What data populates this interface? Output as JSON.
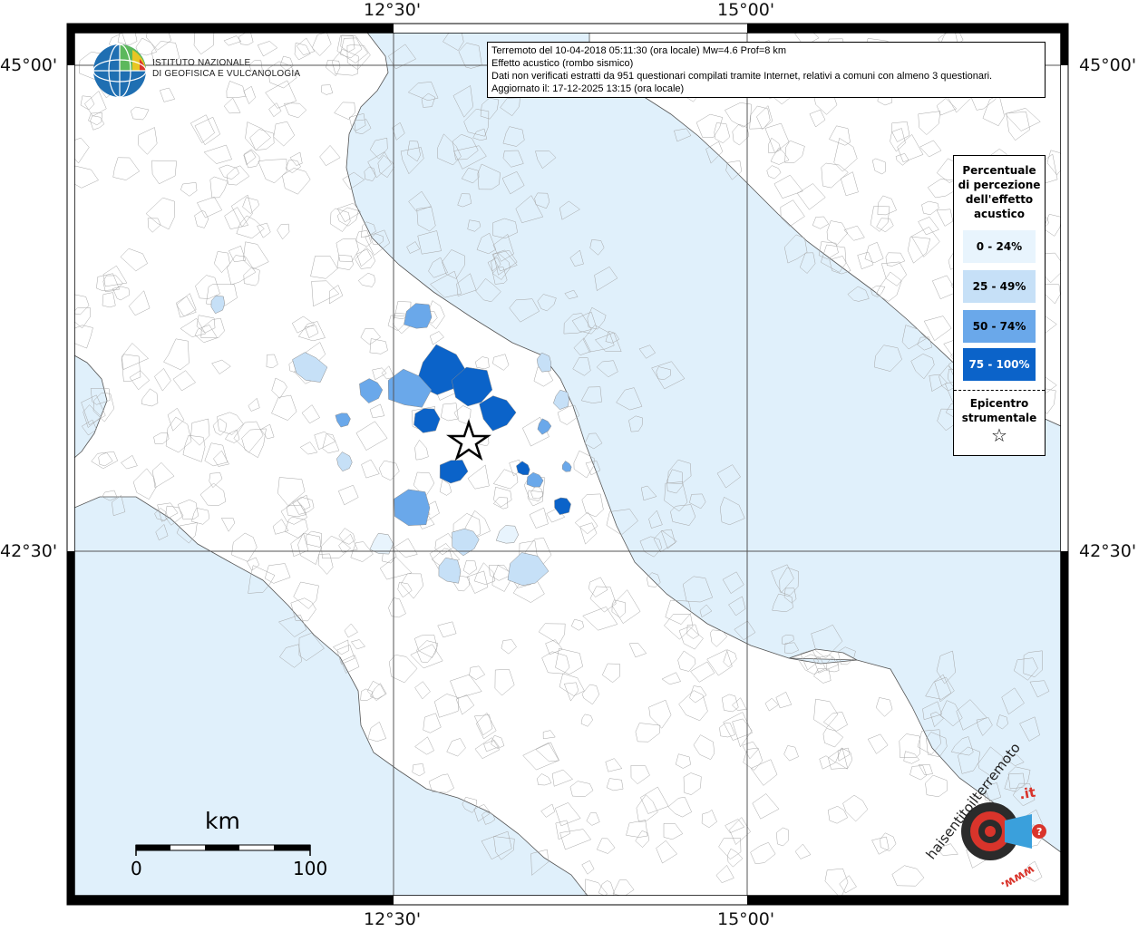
{
  "map": {
    "coord_labels": {
      "top_left_lon": "12°30'",
      "top_right_lon": "15°00'",
      "bottom_left_lon": "12°30'",
      "bottom_right_lon": "15°00'",
      "left_top_lat": "45°00'",
      "left_bottom_lat": "42°30'",
      "right_top_lat": "45°00'",
      "right_bottom_lat": "42°30'"
    },
    "colors": {
      "sea": "#e0f0fb",
      "land": "#ffffff",
      "boundary": "#9a9a9a",
      "frame": "#000000"
    }
  },
  "info": {
    "line1": "Terremoto del 10-04-2018 05:11:30 (ora locale) Mw=4.6 Prof=8 km",
    "line2": "Effetto acustico (rombo sismico)",
    "line3": "Dati non verificati estratti da 951 questionari compilati tramite Internet, relativi a comuni con almeno 3 questionari.",
    "line4": "Aggiornato il: 17-12-2025 13:15 (ora locale)"
  },
  "legend": {
    "title_lines": [
      "Percentuale",
      "di percezione",
      "dell'effetto",
      "acustico"
    ],
    "items": [
      {
        "label": "0 - 24%",
        "color": "#e8f4fd"
      },
      {
        "label": "25 - 49%",
        "color": "#c6e0f7"
      },
      {
        "label": "50 - 74%",
        "color": "#6aa8ea"
      },
      {
        "label": "75 - 100%",
        "color": "#0b63c9"
      }
    ],
    "epicenter_lines": [
      "Epicentro",
      "strumentale"
    ],
    "epicenter_symbol": "☆"
  },
  "logo_ingv": {
    "line1": "ISTITUTO NAZIONALE",
    "line2": "DI GEOFISICA E VULCANOLOGIA"
  },
  "scale": {
    "unit": "km",
    "start": "0",
    "end": "100"
  },
  "logo_hst": {
    "text_main": "haisentitoilterremoto",
    "text_it": ".it",
    "text_www": "www."
  }
}
